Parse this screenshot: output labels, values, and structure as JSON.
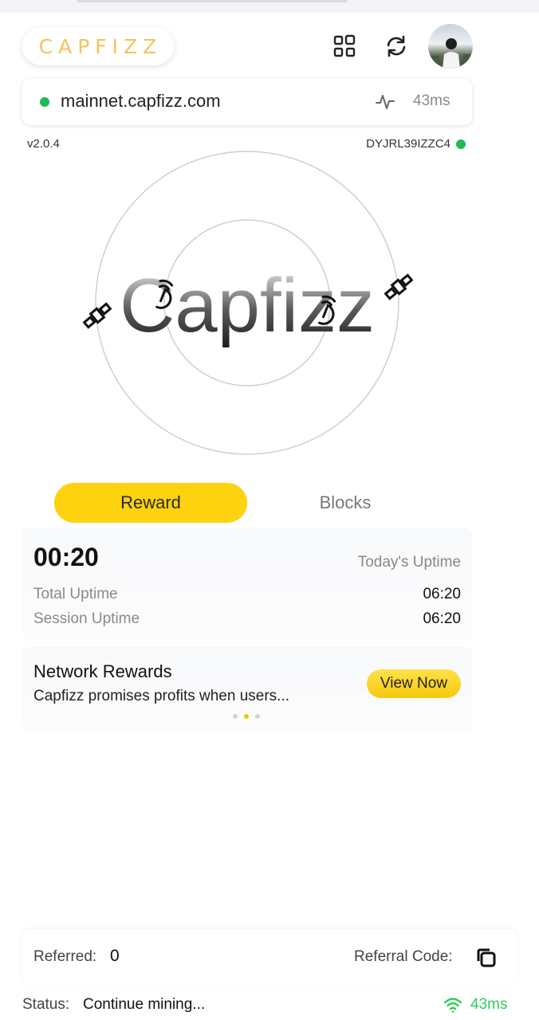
{
  "header": {
    "logo_text": "CAPFIZZ",
    "icons": [
      "grid-icon",
      "refresh-icon",
      "avatar"
    ]
  },
  "network": {
    "host": "mainnet.capfizz.com",
    "latency": "43ms",
    "status_color": "#1db954"
  },
  "meta": {
    "version": "v2.0.4",
    "device_id": "DYJRL39IZZC4"
  },
  "radar": {
    "wordmark": "Capfizz"
  },
  "tabs": [
    {
      "label": "Reward",
      "active": true
    },
    {
      "label": "Blocks",
      "active": false
    }
  ],
  "uptime": {
    "today_value": "00:20",
    "today_label": "Today's Uptime",
    "total_label": "Total Uptime",
    "total_value": "06:20",
    "session_label": "Session Uptime",
    "session_value": "06:20"
  },
  "rewards": {
    "title": "Network Rewards",
    "description": "Capfizz promises profits when users...",
    "button": "View Now",
    "carousel_pages": 3,
    "carousel_active": 2
  },
  "referral": {
    "referred_label": "Referred:",
    "referred_count": "0",
    "code_label": "Referral Code:"
  },
  "status": {
    "label": "Status:",
    "value": "Continue mining...",
    "latency": "43ms"
  },
  "colors": {
    "accent_yellow": "#fdd20f",
    "logo_orange": "#f6c35a",
    "online_green": "#1db954"
  }
}
